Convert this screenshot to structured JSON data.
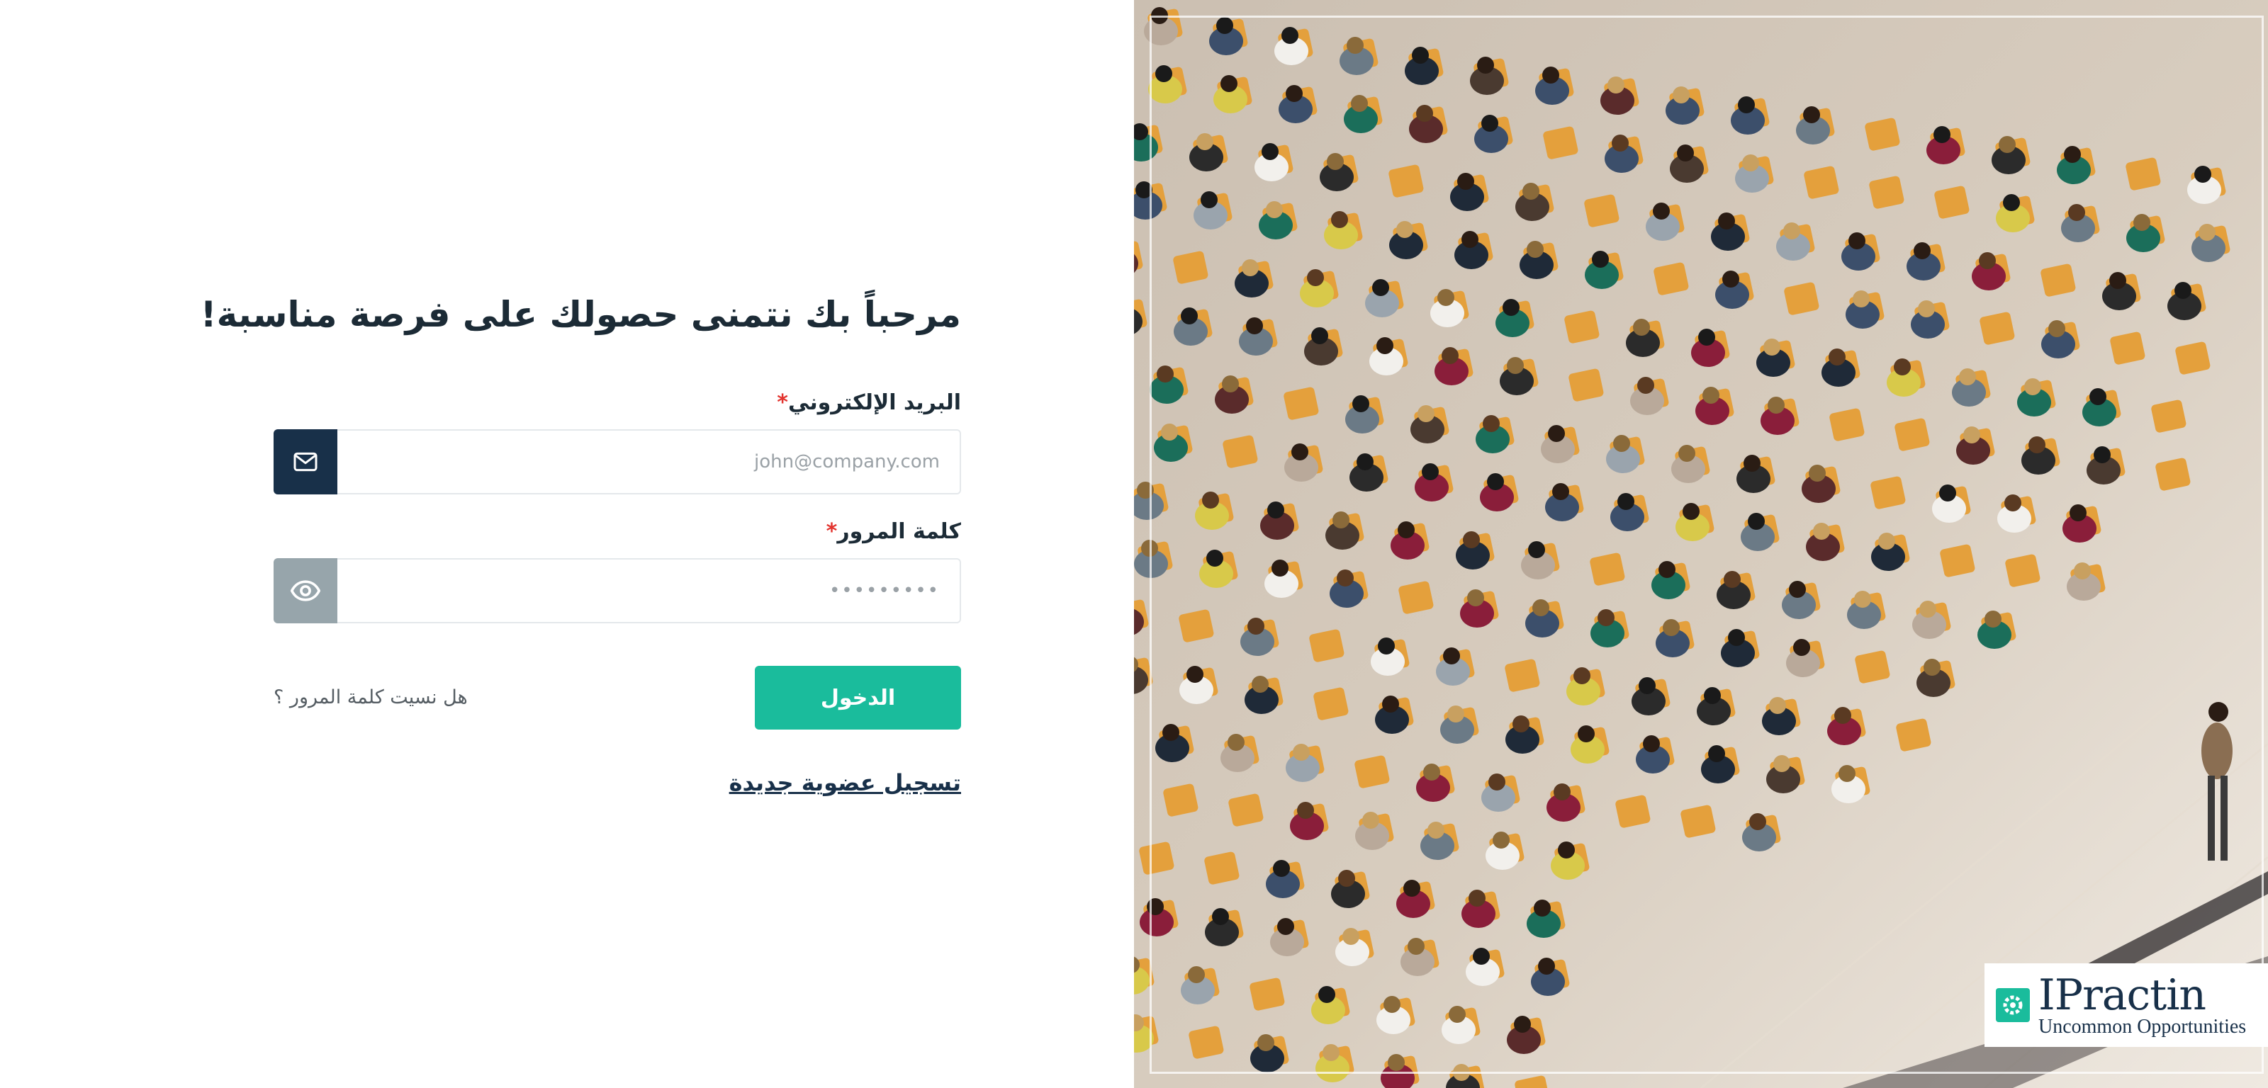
{
  "login_form": {
    "title": "مرحباً بك نتمنى حصولك على فرصة مناسبة!",
    "email": {
      "label": "البريد الإلكتروني",
      "required_mark": "*",
      "placeholder": "john@company.com",
      "icon": "mail-icon"
    },
    "password": {
      "label": "كلمة المرور",
      "required_mark": "*",
      "placeholder": "•••••••••",
      "toggle_icon": "eye-icon"
    },
    "login_button": "الدخول",
    "forgot_password": "هل نسيت كلمة المرور ؟",
    "register_link": "تسجيل عضوية جديدة"
  },
  "logo": {
    "brand": "IPractin",
    "tagline": "Uncommon Opportunities"
  },
  "colors": {
    "primary_dark": "#183049",
    "accent_green": "#1abc9c",
    "required_red": "#e3342f",
    "eye_addon_gray": "#97a5ab"
  }
}
